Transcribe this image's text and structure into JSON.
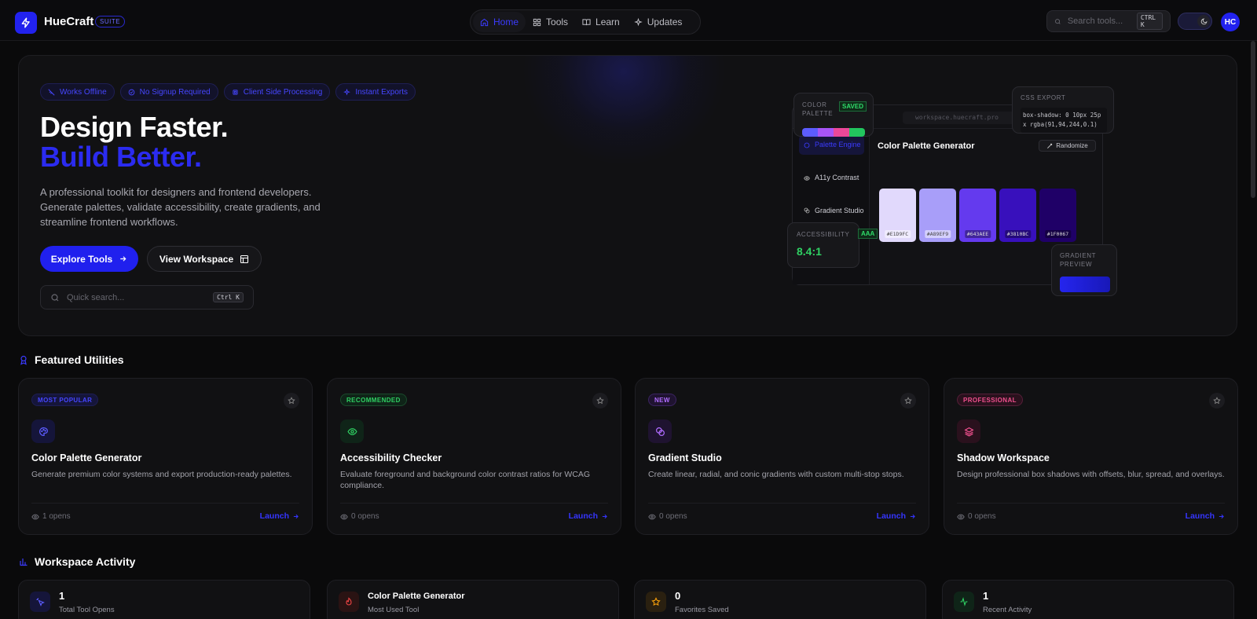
{
  "header": {
    "brand": "HueCraft",
    "suite_badge": "SUITE",
    "nav": [
      {
        "label": "Home",
        "active": true
      },
      {
        "label": "Tools"
      },
      {
        "label": "Learn"
      },
      {
        "label": "Updates"
      }
    ],
    "search_placeholder": "Search tools...",
    "search_shortcut": "CTRL K",
    "avatar": "HC"
  },
  "hero": {
    "chips": [
      "Works Offline",
      "No Signup Required",
      "Client Side Processing",
      "Instant Exports"
    ],
    "title_line1": "Design Faster.",
    "title_line2": "Build Better.",
    "subtitle": "A professional toolkit for designers and frontend developers. Generate palettes, validate accessibility, create gradients, and streamline frontend workflows.",
    "primary_button": "Explore Tools",
    "secondary_button": "View Workspace",
    "quick_search_placeholder": "Quick search...",
    "quick_search_shortcut": "Ctrl K"
  },
  "mockup": {
    "url": "workspace.huecraft.pro",
    "sidebar": [
      {
        "label": "Palette Engine",
        "active": true
      },
      {
        "label": "A11y Contrast"
      },
      {
        "label": "Gradient Studio"
      }
    ],
    "title": "Color Palette Generator",
    "randomize": "Randomize",
    "swatches": [
      {
        "hex": "#E1D9FC",
        "color": "#E1D9FC"
      },
      {
        "hex": "#A89EF9",
        "color": "#A89EF9"
      },
      {
        "hex": "#643AEE",
        "color": "#643AEE"
      },
      {
        "hex": "#3810BC",
        "color": "#3810BC"
      },
      {
        "hex": "#1F0067",
        "color": "#1F0067"
      }
    ],
    "palette_card": {
      "label_line1": "COLOR",
      "label_line2": "PALETTE",
      "badge": "SAVED",
      "colors": [
        "#5c5cff",
        "#a855f7",
        "#ec4899",
        "#22c55e"
      ]
    },
    "css_card": {
      "label": "CSS EXPORT",
      "code_line1": "box-shadow: 0 10px 25p",
      "code_line2": "x rgba(91,94,244,0.1)"
    },
    "access_card": {
      "label": "ACCESSIBILITY",
      "value": "8.4:1",
      "badge": "AAA"
    },
    "gradient_card": {
      "label_line1": "GRADIENT",
      "label_line2": "PREVIEW"
    }
  },
  "featured": {
    "title": "Featured Utilities",
    "cards": [
      {
        "tag": "MOST POPULAR",
        "tag_color": "#3b3bff",
        "name": "Color Palette Generator",
        "desc": "Generate premium color systems and export production-ready palettes.",
        "opens": "1 opens",
        "launch": "Launch"
      },
      {
        "tag": "RECOMMENDED",
        "tag_color": "#22c55e",
        "name": "Accessibility Checker",
        "desc": "Evaluate foreground and background color contrast ratios for WCAG compliance.",
        "opens": "0 opens",
        "launch": "Launch"
      },
      {
        "tag": "NEW",
        "tag_color": "#a855f7",
        "name": "Gradient Studio",
        "desc": "Create linear, radial, and conic gradients with custom multi-stop stops.",
        "opens": "0 opens",
        "launch": "Launch"
      },
      {
        "tag": "PROFESSIONAL",
        "tag_color": "#ec4899",
        "name": "Shadow Workspace",
        "desc": "Design professional box shadows with offsets, blur, spread, and overlays.",
        "opens": "0 opens",
        "launch": "Launch"
      }
    ]
  },
  "activity": {
    "title": "Workspace Activity",
    "stats": [
      {
        "value": "1",
        "label": "Total Tool Opens"
      },
      {
        "value": "Color Palette Generator",
        "label": "Most Used Tool"
      },
      {
        "value": "0",
        "label": "Favorites Saved"
      },
      {
        "value": "1",
        "label": "Recent Activity"
      }
    ]
  }
}
